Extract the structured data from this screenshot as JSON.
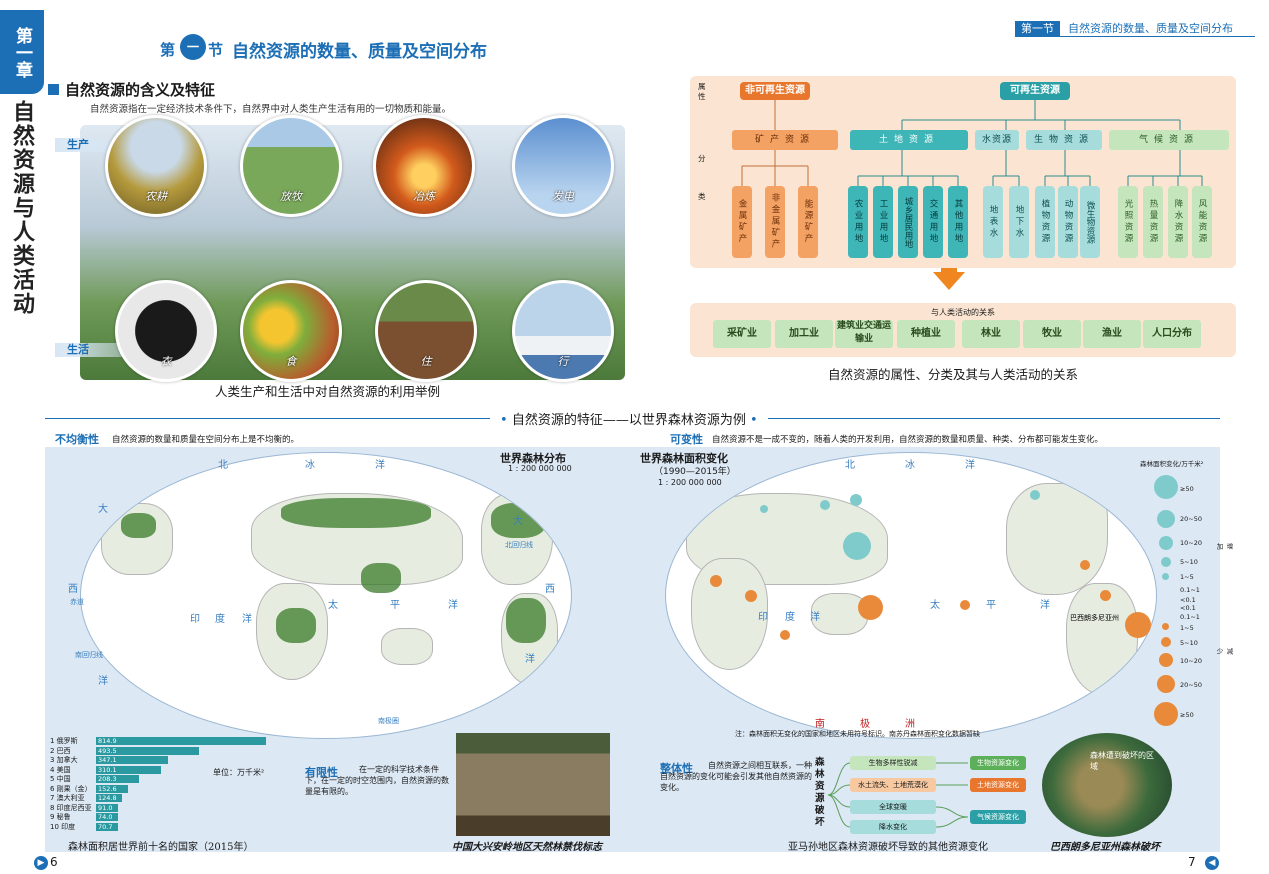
{
  "chapter": {
    "badge": "第一章",
    "title": "自然资源与人类活动"
  },
  "section": {
    "prefix": "第",
    "number": "一",
    "suffix": "节",
    "title": "自然资源的数量、质量及空间分布"
  },
  "running_head": {
    "tag": "第一节",
    "text": "自然资源的数量、质量及空间分布"
  },
  "meaning": {
    "heading": "自然资源的含义及特征",
    "text": "自然资源指在一定经济技术条件下，自然界中对人类生产生活有用的一切物质和能量。",
    "label_production": "生产",
    "label_life": "生活",
    "photos": [
      "农耕",
      "放牧",
      "冶炼",
      "发电",
      "衣",
      "食",
      "住",
      "行"
    ],
    "caption": "人类生产和生活中对自然资源的利用举例"
  },
  "diagram": {
    "attr_label": "属性",
    "class_label": "分类",
    "nonrenewable": "非可再生资源",
    "renewable": "可再生资源",
    "categories": [
      "矿产资源",
      "土地资源",
      "水资源",
      "生物资源",
      "气候资源"
    ],
    "mineral": [
      "金属矿产",
      "非金属矿产",
      "能源矿产"
    ],
    "land": [
      "农业用地",
      "工业用地",
      "城乡居民用地",
      "交通用地",
      "其他用地"
    ],
    "water": [
      "地表水",
      "地下水"
    ],
    "bio": [
      "植物资源",
      "动物资源",
      "微生物资源"
    ],
    "climate": [
      "光照资源",
      "热量资源",
      "降水资源",
      "风能资源"
    ],
    "relation_title": "与人类活动的关系",
    "activities": [
      "采矿业",
      "加工业",
      "建筑业交通运输业",
      "种植业",
      "林业",
      "牧业",
      "渔业",
      "人口分布"
    ],
    "caption": "自然资源的属性、分类及其与人类活动的关系"
  },
  "features": {
    "title": "自然资源的特征——以世界森林资源为例",
    "uneven_heading": "不均衡性",
    "uneven_text": "自然资源的数量和质量在空间分布上是不均衡的。",
    "change_heading": "可变性",
    "change_text": "自然资源不是一成不变的，随着人类的开发利用，自然资源的数量和质量、种类、分布都可能发生变化。",
    "limited_heading": "有限性",
    "limited_text": "在一定的科学技术条件下，在一定的时空范围内，自然资源的数量是有限的。",
    "whole_heading": "整体性",
    "whole_text": "自然资源之间相互联系，一种自然资源的变化可能会引发其他自然资源的变化。"
  },
  "map1": {
    "title": "世界森林分布",
    "scale": "1 : 200 000 000",
    "labels": [
      "北",
      "冰",
      "洋",
      "大",
      "西",
      "洋",
      "太",
      "平",
      "洋",
      "印",
      "度",
      "洋",
      "大",
      "西",
      "洋",
      "北回归线",
      "赤道",
      "南回归线",
      "南极圈"
    ]
  },
  "map2": {
    "title": "世界森林面积变化",
    "years": "（1990—2015年）",
    "scale": "1 : 200 000 000",
    "labels": [
      "北",
      "冰",
      "洋",
      "太",
      "平",
      "洋",
      "印",
      "度",
      "洋",
      "南",
      "极",
      "洲",
      "巴西朗多尼亚州"
    ],
    "note": "注：森林面积无变化的国家和地区未用符号标识。南苏丹森林面积变化数据暂缺"
  },
  "legend": {
    "title": "森林面积变化/万千米²",
    "increase": "增加",
    "decrease": "减少",
    "inc_items": [
      "≥50",
      "20~50",
      "10~20",
      "5~10",
      "1~5",
      "0.1~1",
      "<0.1"
    ],
    "dec_items": [
      "<0.1",
      "0.1~1",
      "1~5",
      "5~10",
      "10~20",
      "20~50",
      "≥50"
    ]
  },
  "top10": {
    "unit": "单位：万千米²",
    "caption": "森林面积居世界前十名的国家（2015年）",
    "rows": [
      {
        "rank": "1",
        "name": "俄罗斯",
        "value": 814.9
      },
      {
        "rank": "2",
        "name": "巴西",
        "value": 493.5
      },
      {
        "rank": "3",
        "name": "加拿大",
        "value": 347.1
      },
      {
        "rank": "4",
        "name": "美国",
        "value": 310.1
      },
      {
        "rank": "5",
        "name": "中国",
        "value": 208.3
      },
      {
        "rank": "6",
        "name": "刚果（金）",
        "value": 152.6
      },
      {
        "rank": "7",
        "name": "澳大利亚",
        "value": 124.8
      },
      {
        "rank": "8",
        "name": "印度尼西亚",
        "value": 91.0
      },
      {
        "rank": "9",
        "name": "秘鲁",
        "value": 74.0
      },
      {
        "rank": "10",
        "name": "印度",
        "value": 70.7
      }
    ]
  },
  "sign_caption": "中国大兴安岭地区天然林禁伐标志",
  "chain": {
    "left": "森林资源破坏",
    "mid": [
      "生物多样性锐减",
      "水土流失、土地荒漠化",
      "全球变暖",
      "降水变化"
    ],
    "right": [
      "生物资源变化",
      "土地资源变化",
      "气候资源变化"
    ],
    "caption": "亚马孙地区森林资源破坏导致的其他资源变化"
  },
  "sat": {
    "label": "森林遭到破坏的区域",
    "caption": "巴西朗多尼亚州森林破坏"
  },
  "pages": {
    "left": "6",
    "right": "7"
  }
}
